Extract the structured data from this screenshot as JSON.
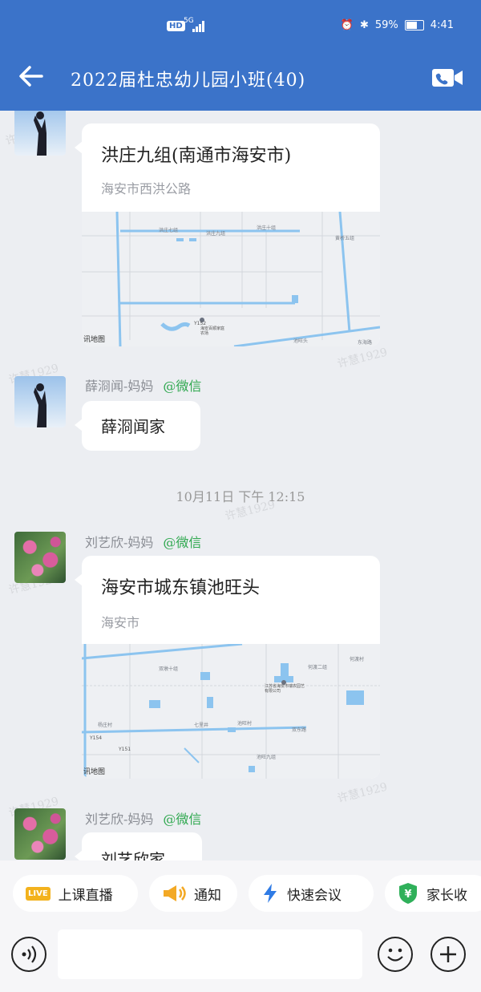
{
  "status": {
    "hd": "HD",
    "network": "5G",
    "battery": "59%",
    "time": "4:41"
  },
  "header": {
    "title": "2022届杜忠幼儿园小班(40)"
  },
  "messages": {
    "m1": {
      "title": "洪庄九组(南通市海安市)",
      "subtitle": "海安市西洪公路",
      "map_credit": "讯地图",
      "map_labels": {
        "a": "洪庄七组",
        "b": "洪庄九组",
        "c": "洪庄十组",
        "d": "黄桥五组",
        "e": "Y152",
        "f": "海安百顺家庭农场",
        "g": "池旺头",
        "h": "东海路"
      }
    },
    "m2": {
      "sender": "薛浻闻-妈妈",
      "source": "@微信",
      "text": "薛浻闻家"
    },
    "m3": {
      "sender": "刘艺欣-妈妈",
      "source": "@微信",
      "title": "海安市城东镇池旺头",
      "subtitle": "海安市",
      "map_credit": "讯地图",
      "map_labels": {
        "a": "双墩十组",
        "b": "何渡二组",
        "c": "何渡村",
        "d": "江苏省海安市瑞农园艺有限公司",
        "e": "杨庄村",
        "f": "七里井",
        "g": "池旺村",
        "h": "双东路",
        "i": "Y154",
        "j": "Y151",
        "k": "池旺九组"
      }
    },
    "m4": {
      "sender": "刘艺欣-妈妈",
      "source": "@微信",
      "text": "刘艺欣家"
    }
  },
  "timestamp": "10月11日 下午 12:15",
  "watermark": "许慧1929",
  "toolbar": {
    "live": "上课直播",
    "notice": "通知",
    "meeting": "快速会议",
    "fee": "家长收"
  },
  "colors": {
    "header": "#3b73c9",
    "wechat": "#2fa84f"
  },
  "icons": {
    "back": "arrow-left-icon",
    "video": "video-call-icon",
    "voice": "voice-icon",
    "emoji": "emoji-icon",
    "add": "plus-icon"
  }
}
